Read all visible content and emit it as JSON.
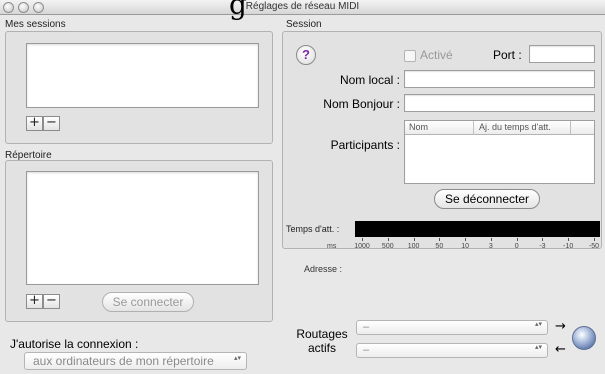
{
  "window": {
    "title": "Réglages de réseau MIDI",
    "title_glyph": "g"
  },
  "left": {
    "sessions_label": "Mes sessions",
    "repertoire_label": "Répertoire",
    "plus": "+",
    "minus": "−",
    "connect_button": "Se connecter",
    "allow_label": "J'autorise la connexion :",
    "allow_value": "aux ordinateurs de mon répertoire",
    "stepper": "▴▾"
  },
  "session": {
    "section_label": "Session",
    "help": "?",
    "enabled_label": "Activé",
    "port_label": "Port :",
    "port_value": "",
    "local_name_label": "Nom local :",
    "local_name_value": "",
    "bonjour_name_label": "Nom Bonjour :",
    "bonjour_name_value": "",
    "participants_label": "Participants :",
    "participants_columns": [
      "Nom",
      "Aj. du temps d'att."
    ],
    "disconnect_button": "Se déconnecter",
    "latency_label": "Temps d'att. :",
    "latency_unit": "ms",
    "latency_ticks": [
      "1000",
      "500",
      "100",
      "50",
      "10",
      "3",
      "0",
      "-3",
      "-10",
      "-50"
    ],
    "address_label": "Adresse :",
    "address_value": ""
  },
  "routing": {
    "label_line1": "Routages",
    "label_line2": "actifs",
    "popup1_value": "–",
    "popup2_value": "–",
    "arrow_out": "→",
    "arrow_in": "←",
    "stepper": "▴▾"
  }
}
